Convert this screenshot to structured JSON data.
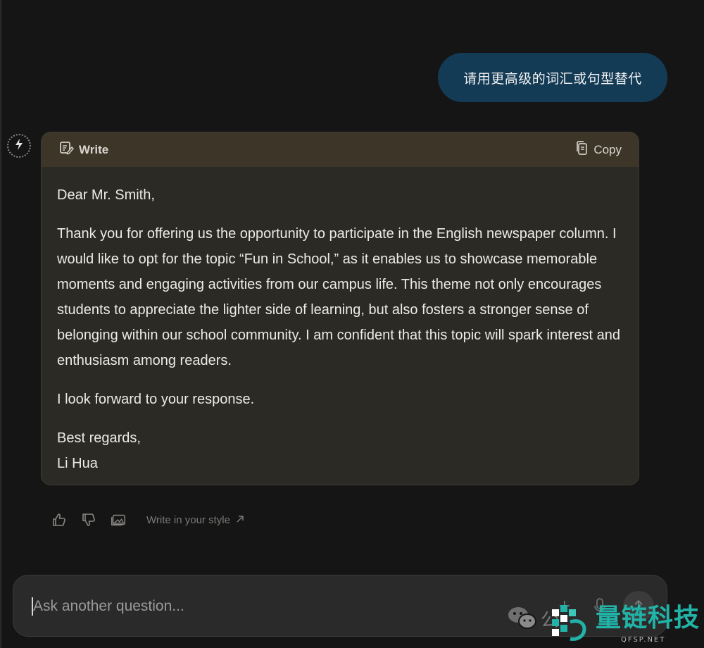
{
  "conversation": {
    "user_message": "请用更高级的词汇或句型替代"
  },
  "response_card": {
    "mode_label": "Write",
    "mode_icon": "write-icon",
    "copy_label": "Copy",
    "copy_icon": "copy-icon",
    "greeting": "Dear Mr. Smith,",
    "body": "Thank you for offering us the opportunity to participate in the English newspaper column. I would like to opt for the topic “Fun in School,” as it enables us to showcase memorable moments and engaging activities from our campus life. This theme not only encourages students to appreciate the lighter side of learning, but also fosters a stronger sense of belonging within our school community. I am confident that this topic will spark interest and enthusiasm among readers.",
    "closing_line": "I look forward to your response.",
    "signoff": "Best regards,",
    "signature": "Li Hua"
  },
  "actions": {
    "thumbs_up_icon": "thumbs-up-icon",
    "thumbs_down_icon": "thumbs-down-icon",
    "image_icon": "image-icon",
    "style_link_label": "Write in your style",
    "style_link_icon": "arrow-up-right-icon"
  },
  "composer": {
    "placeholder": "Ask another question...",
    "add_icon": "plus-icon",
    "mic_icon": "microphone-icon",
    "send_icon": "arrow-up-icon"
  },
  "watermark": {
    "chinese_fragment": "公",
    "brand_name": "量链科技",
    "brand_url": "QFSP.NET"
  },
  "colors": {
    "background": "#151515",
    "user_bubble": "#143b56",
    "card_bg": "#2c2a25",
    "card_header": "#3d3528",
    "brand_teal": "#22b3a8"
  }
}
